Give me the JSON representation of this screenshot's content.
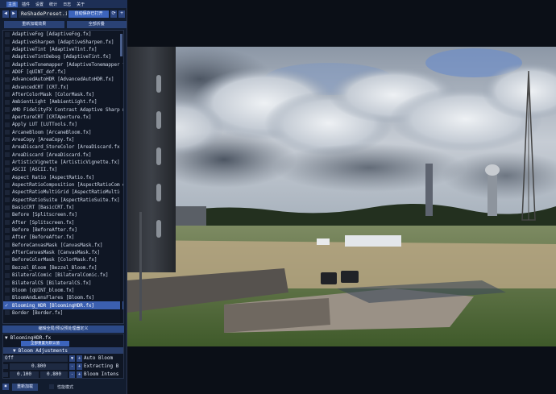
{
  "menu": {
    "items": [
      "主页",
      "插件",
      "设置",
      "统计",
      "日志",
      "关于"
    ]
  },
  "preset": {
    "prev_icon": "◀",
    "next_icon": "▶",
    "name": "ReShadePreset.ini",
    "save_label": "自动保存已打开",
    "reload_icon": "⟳",
    "add_icon": "+"
  },
  "actions": {
    "reload_effects": "重新加载效果",
    "collapse_all": "全部折叠"
  },
  "effects": [
    "AdaptiveFog [AdaptiveFog.fx]",
    "AdaptiveSharpen [AdaptiveSharpen.fx]",
    "AdaptiveTint [AdaptiveTint.fx]",
    "AdaptiveTintDebug [AdaptiveTint.fx]",
    "AdaptiveTonemapper [AdaptiveTonemapper.fx]",
    "ADOF [qUINT_dof.fx]",
    "AdvancedAutoHDR [AdvancedAutoHDR.fx]",
    "AdvancedCRT [CRT.fx]",
    "AfterColorMask [ColorMask.fx]",
    "AmbientLight [AmbientLight.fx]",
    "AMD FidelityFX Contrast Adaptive Sharpening",
    "ApertureCRT [CRTAperture.fx]",
    "Apply LUT [LUTTools.fx]",
    "ArcaneBloom [ArcaneBloom.fx]",
    "AreaCopy [AreaCopy.fx]",
    "AreaDiscard_StoreColor [AreaDiscard.fx]",
    "AreaDiscard [AreaDiscard.fx]",
    "ArtisticVignette [ArtisticVignette.fx]",
    "ASCII [ASCII.fx]",
    "Aspect Ratio [AspectRatio.fx]",
    "AspectRatioComposition [AspectRatioComposition.fx]",
    "AspectRatioMultiGrid [AspectRatioMultiGrid.fx]",
    "AspectRatioSuite [AspectRatioSuite.fx]",
    "BasicCRT [BasicCRT.fx]",
    "Before [Splitscreen.fx]",
    "After [Splitscreen.fx]",
    "Before [BeforeAfter.fx]",
    "After [BeforeAfter.fx]",
    "BeforeCanvasMask [CanvasMask.fx]",
    "AfterCanvasMask [CanvasMask.fx]",
    "BeforeColorMask [ColorMask.fx]",
    "Bezzel_Bloom [Bezzel_Bloom.fx]",
    "BilateralComic [BilateralComic.fx]",
    "BilateralCS [BilateralCS.fx]",
    "Bloom [qUINT_bloom.fx]",
    "BloomAndLensFlares [Bloom.fx]",
    "Blooming_HDR [BloomingHDR.fx]",
    "Border [Border.fx]"
  ],
  "effects_state": {
    "checked_index": 36,
    "check_glyph": "✓"
  },
  "splitter_label": "编辑全局/预设预处理器定义",
  "params": {
    "file_name": "BloomingHDR.fx",
    "file_toggle": "▼",
    "reset_label": "全部重置为默认值",
    "category_toggle": "▼",
    "category_label": "Bloom Adjustments",
    "auto_bloom_value": "Off",
    "auto_bloom_label": "Auto Bloom",
    "extracting_value": "0.800",
    "extracting_label": "Extracting B",
    "intensity_value_1": "0.100",
    "intensity_value_2": "0.800",
    "intensity_label": "Bloom Intens",
    "minus_glyph": "-",
    "plus_glyph": "+",
    "dropdown_glyph": "▼"
  },
  "bottom": {
    "icon": "✖",
    "reload_label": "重新加载",
    "perf_label": "性能模式"
  },
  "colors": {
    "menu_bg": "#1d2f56",
    "accent": "#3c64bc",
    "panel_bg": "#121c2e",
    "selected_row": "#3b5fb0"
  }
}
